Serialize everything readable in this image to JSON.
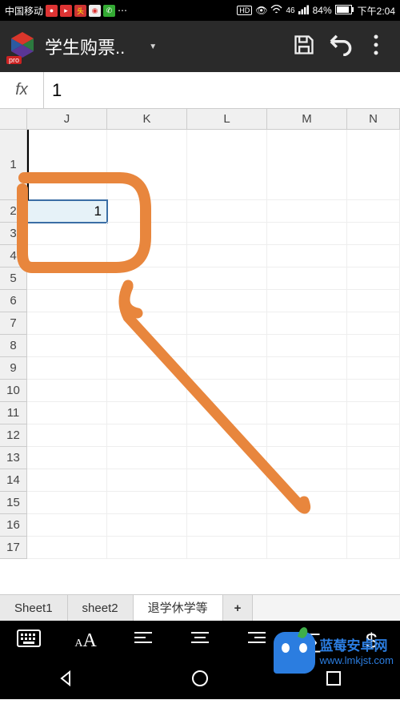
{
  "status": {
    "carrier": "中国移动",
    "hd": "HD",
    "signal": "46",
    "battery": "84%",
    "time": "下午2:04"
  },
  "app": {
    "logo_badge": "pro",
    "title": "学生购票..",
    "save_label": "Save",
    "undo_label": "Undo",
    "menu_label": "Menu"
  },
  "formula": {
    "fx_label": "fx",
    "value": "1"
  },
  "grid": {
    "columns": [
      "J",
      "K",
      "L",
      "M",
      "N"
    ],
    "rows": [
      "1",
      "2",
      "3",
      "4",
      "5",
      "6",
      "7",
      "8",
      "9",
      "10",
      "11",
      "12",
      "13",
      "14",
      "15",
      "16",
      "17"
    ],
    "selected_cell_value": "1"
  },
  "tabs": {
    "items": [
      "Sheet1",
      "sheet2",
      "退学休学等"
    ],
    "add": "+",
    "active_index": 2
  },
  "toolbar": {
    "sum": "∑",
    "currency": "$"
  },
  "watermark": {
    "line1": "蓝莓安卓网",
    "line2": "www.lmkjst.com"
  }
}
